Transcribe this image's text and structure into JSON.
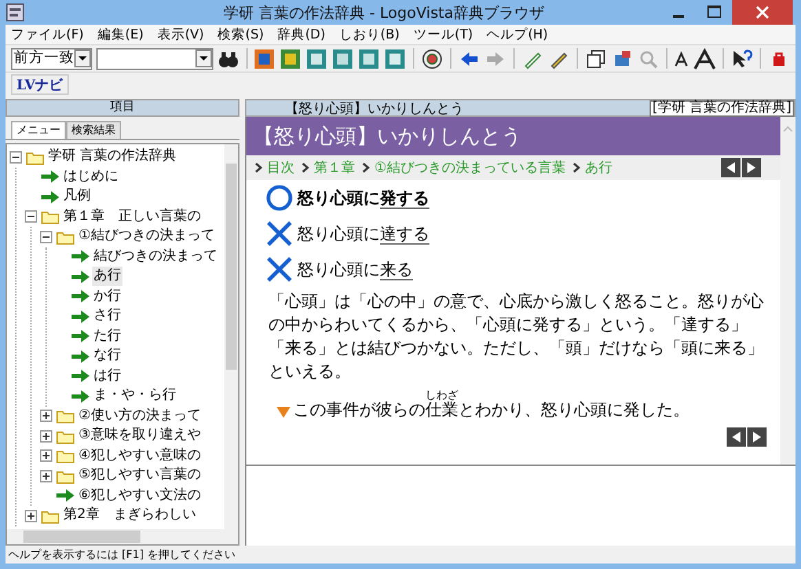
{
  "window": {
    "title": "学研 言葉の作法辞典 - LogoVista辞典ブラウザ"
  },
  "menu": [
    "ファイル(F)",
    "編集(E)",
    "表示(V)",
    "検索(S)",
    "辞典(D)",
    "しおり(B)",
    "ツール(T)",
    "ヘルプ(H)"
  ],
  "toolbar": {
    "match_mode": "前方一致"
  },
  "nav_toolbar": {
    "button": "LVナビ"
  },
  "left_pane": {
    "header": "項目",
    "tabs": [
      {
        "label": "メニュー",
        "selected": true
      },
      {
        "label": "検索結果",
        "selected": false
      }
    ],
    "tree": [
      {
        "kind": "folder",
        "label": "学研 言葉の作法辞典",
        "expanded": true,
        "selected": false,
        "children": [
          {
            "kind": "page",
            "label": "はじめに",
            "selected": false
          },
          {
            "kind": "page",
            "label": "凡例",
            "selected": false
          },
          {
            "kind": "folder",
            "label": "第１章　正しい言葉の",
            "expanded": true,
            "selected": false,
            "children": [
              {
                "kind": "folder",
                "label": "①結びつきの決まって",
                "expanded": true,
                "selected": false,
                "children": [
                  {
                    "kind": "page",
                    "label": "結びつきの決まって",
                    "selected": false
                  },
                  {
                    "kind": "page",
                    "label": "あ行",
                    "selected": true
                  },
                  {
                    "kind": "page",
                    "label": "か行",
                    "selected": false
                  },
                  {
                    "kind": "page",
                    "label": "さ行",
                    "selected": false
                  },
                  {
                    "kind": "page",
                    "label": "た行",
                    "selected": false
                  },
                  {
                    "kind": "page",
                    "label": "な行",
                    "selected": false
                  },
                  {
                    "kind": "page",
                    "label": "は行",
                    "selected": false
                  },
                  {
                    "kind": "page",
                    "label": "ま・や・ら行",
                    "selected": false
                  }
                ]
              },
              {
                "kind": "folder",
                "label": "②使い方の決まって",
                "expanded": false,
                "selected": false
              },
              {
                "kind": "folder",
                "label": "③意味を取り違えや",
                "expanded": false,
                "selected": false
              },
              {
                "kind": "folder",
                "label": "④犯しやすい意味の",
                "expanded": false,
                "selected": false
              },
              {
                "kind": "folder",
                "label": "⑤犯しやすい言葉の",
                "expanded": false,
                "selected": false
              },
              {
                "kind": "page",
                "label": "⑥犯しやすい文法の",
                "selected": false
              }
            ]
          },
          {
            "kind": "folder",
            "label": "第2章　まぎらわしい",
            "expanded": false,
            "selected": false
          }
        ]
      }
    ]
  },
  "right_pane": {
    "header_title": "【怒り心頭】いかりしんとう",
    "header_dictionary": "[学研 言葉の作法辞典]",
    "heading": "【怒り心頭】いかりしんとう",
    "breadcrumb": [
      "目次",
      "第１章",
      "①結びつきの決まっている言葉",
      "あ行"
    ],
    "usages": [
      {
        "kind": "correct",
        "text": "怒り心頭に",
        "underlined": "発する"
      },
      {
        "kind": "wrong",
        "text": "怒り心頭に",
        "underlined": "達する"
      },
      {
        "kind": "wrong",
        "text": "怒り心頭に",
        "underlined": "来る"
      }
    ],
    "explanation": "「心頭」は「心の中」の意で、心底から激しく怒ること。怒りが心の中からわいてくるから、「心頭に発する」という。「達する」「来る」とは結びつかない。ただし、「頭」だけなら「頭に来る」といえる。",
    "example": {
      "before": "この事件が彼らの",
      "ruby_base": "仕業",
      "ruby": "しわざ",
      "after": "とわかり、怒り心頭に発した。"
    }
  },
  "status_bar": "ヘルプを表示するには [F1] を押してください"
}
